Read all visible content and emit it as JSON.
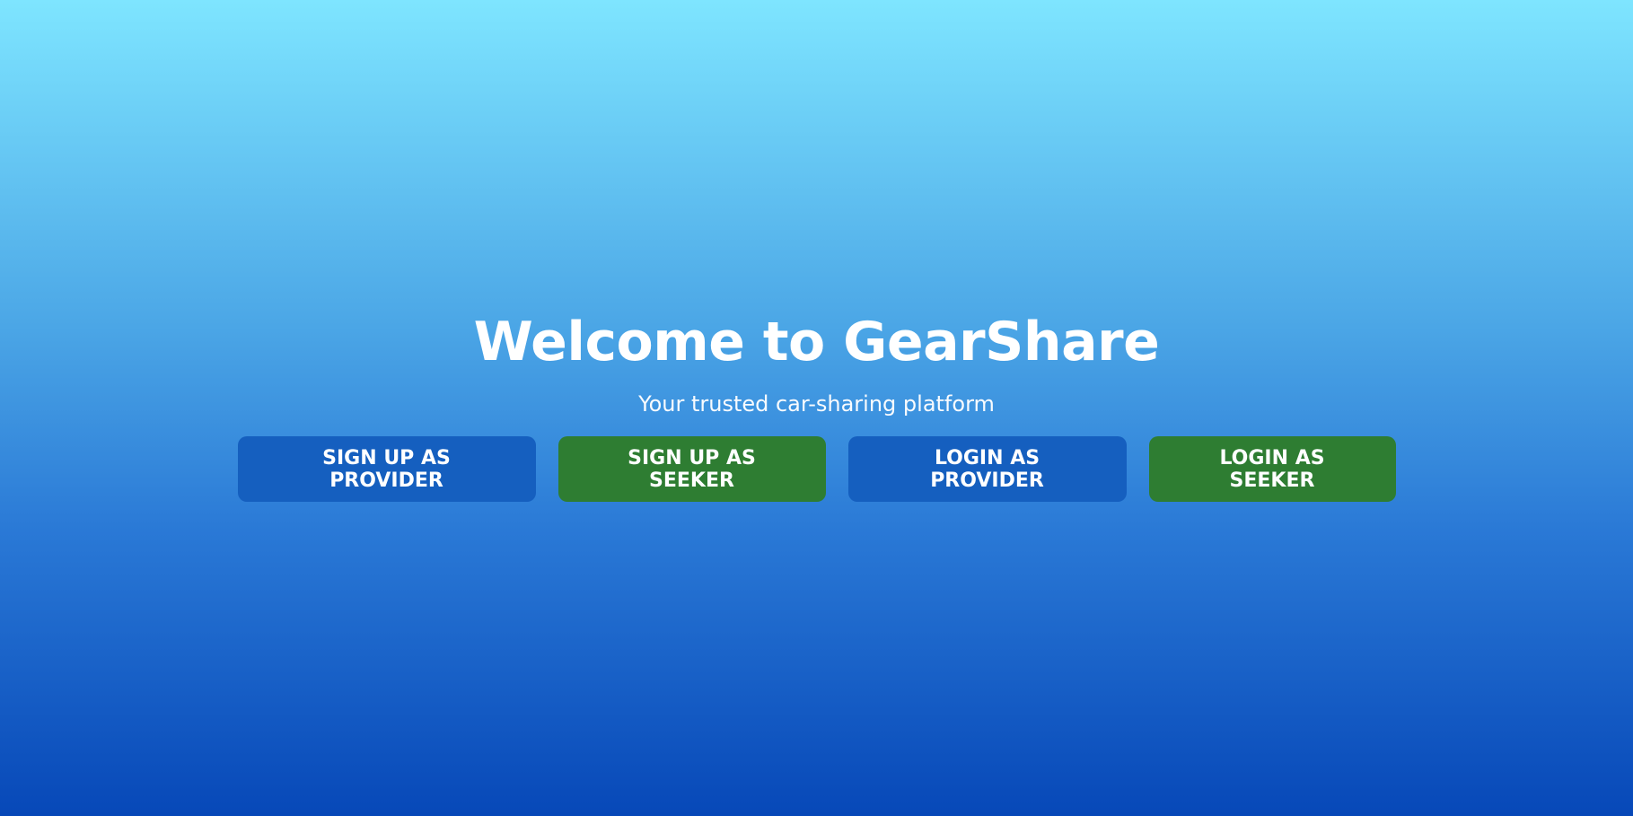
{
  "hero": {
    "title": "Welcome to GearShare",
    "subtitle": "Your trusted car-sharing platform"
  },
  "actions": {
    "signup_provider": "SIGN UP AS PROVIDER",
    "signup_seeker": "SIGN UP AS SEEKER",
    "login_provider": "LOGIN AS PROVIDER",
    "login_seeker": "LOGIN AS SEEKER"
  },
  "colors": {
    "provider_button": "#155fbf",
    "seeker_button": "#2e7d32",
    "gradient_top": "#7ee5ff",
    "gradient_bottom": "#0748b8"
  }
}
